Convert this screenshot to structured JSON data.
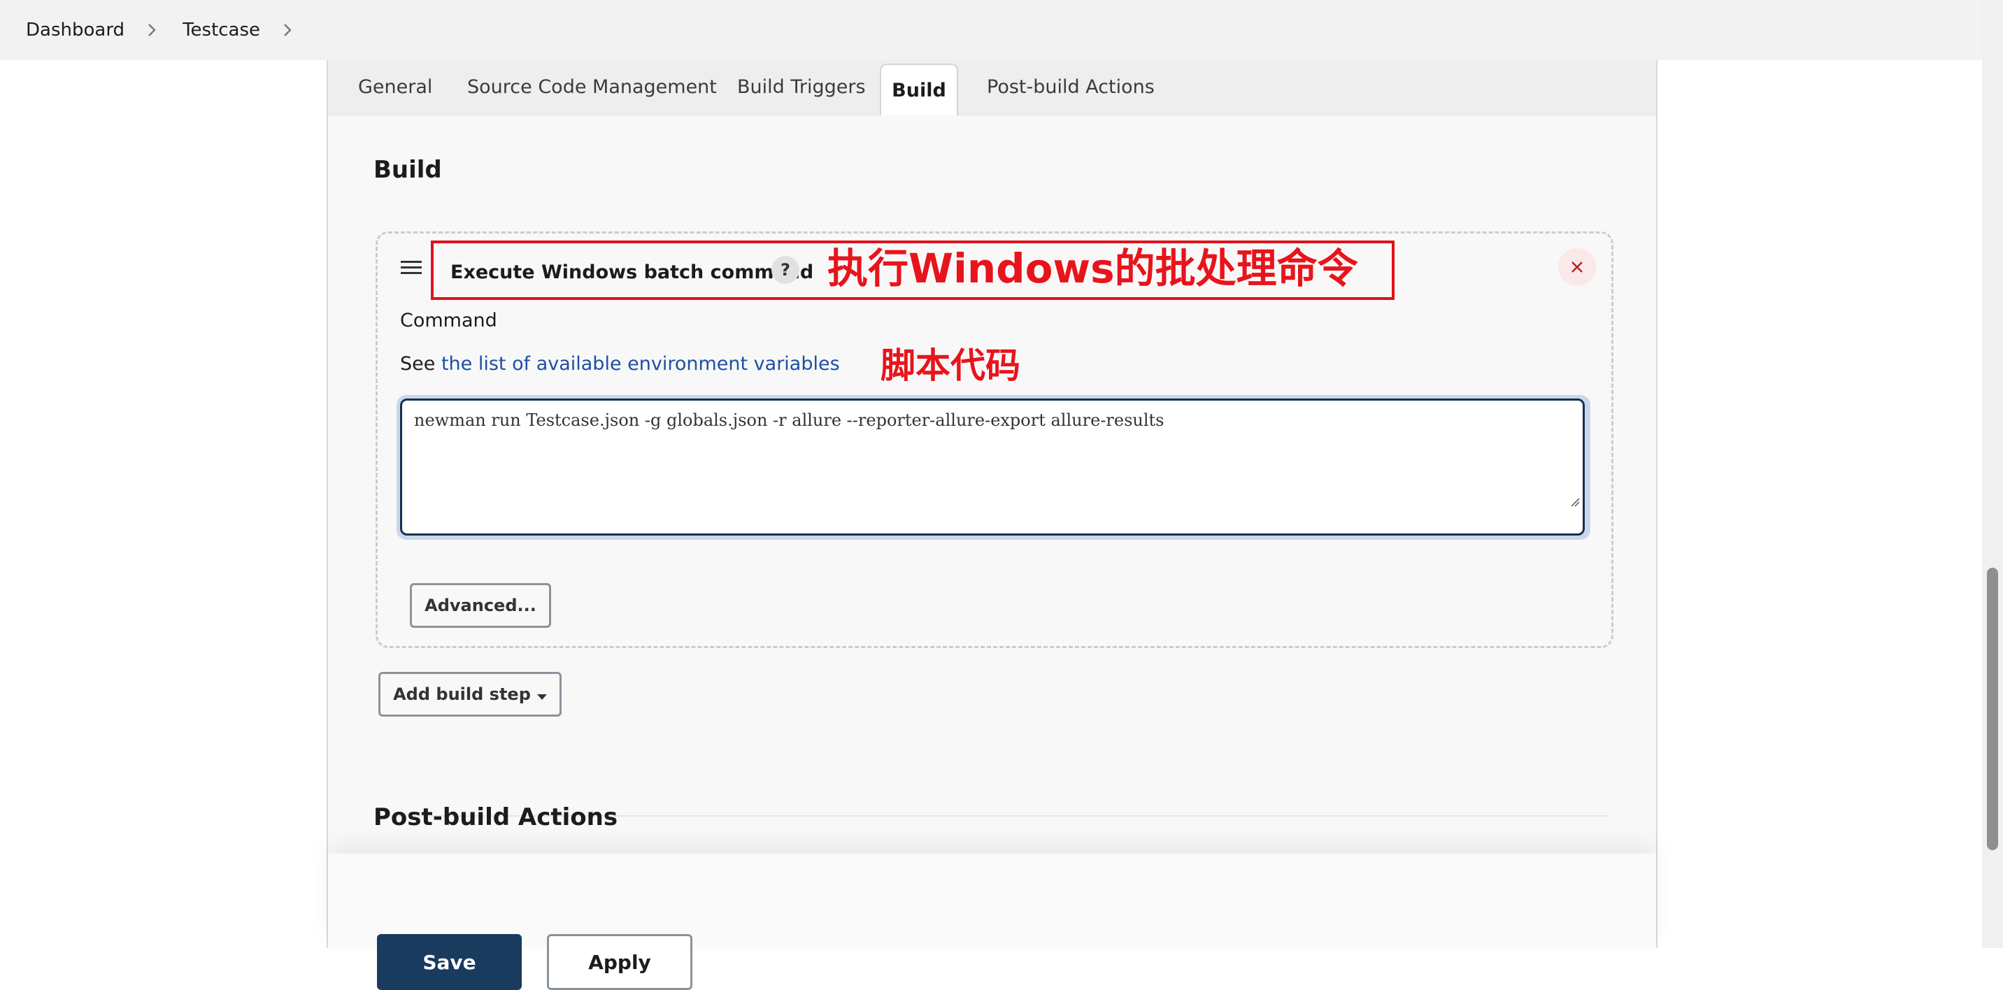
{
  "breadcrumb": {
    "items": [
      "Dashboard",
      "Testcase"
    ]
  },
  "tabs": [
    {
      "label": "General"
    },
    {
      "label": "Source Code Management"
    },
    {
      "label": "Build Triggers"
    },
    {
      "label": "Build"
    },
    {
      "label": "Post-build Actions"
    }
  ],
  "build": {
    "section_title": "Build",
    "step": {
      "title": "Execute Windows batch command",
      "help": "?",
      "command_label": "Command",
      "env_prefix": "See ",
      "env_link": "the list of available environment variables",
      "command": "newman run Testcase.json -g globals.json -r allure --reporter-allure-export allure-results",
      "advanced_label": "Advanced..."
    },
    "add_step_label": "Add build step"
  },
  "post_build": {
    "section_title": "Post-build Actions"
  },
  "footer": {
    "save_label": "Save",
    "apply_label": "Apply"
  },
  "annotations": {
    "header_note": "执行Windows的批处理命令",
    "script_note": "脚本代码",
    "color": "#e8141c"
  }
}
